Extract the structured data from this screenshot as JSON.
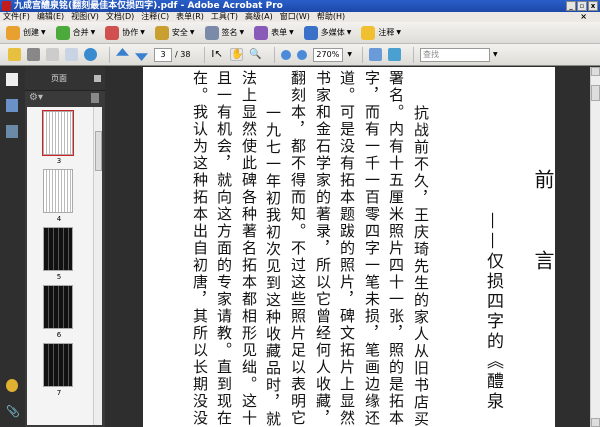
{
  "window": {
    "title": "九成宫醴泉铭(翻刻最佳本仅损四字).pdf - Adobe Acrobat Pro",
    "min": "_",
    "restore": "▫",
    "close": "x"
  },
  "menu": [
    "文件(F)",
    "编辑(E)",
    "视图(V)",
    "文档(D)",
    "注释(C)",
    "表单(R)",
    "工具(T)",
    "高级(A)",
    "窗口(W)",
    "帮助(H)"
  ],
  "menu_close": "×",
  "toolbar1": [
    {
      "label": "创建",
      "color": "#e8a030"
    },
    {
      "label": "合并",
      "color": "#4caa3c"
    },
    {
      "label": "协作",
      "color": "#d05050"
    },
    {
      "label": "安全",
      "color": "#c9a030"
    },
    {
      "label": "签名",
      "color": "#7a8aa8"
    },
    {
      "label": "表单",
      "color": "#8a5ab8"
    },
    {
      "label": "多媒体",
      "color": "#3a70c8"
    },
    {
      "label": "注释",
      "color": "#f0c030"
    }
  ],
  "toolbar2": {
    "current_page": "3",
    "total_pages": "/ 38",
    "zoom": "270%",
    "find_placeholder": "查找"
  },
  "panel": {
    "title": "页面",
    "thumbnails": [
      {
        "num": "3",
        "style": "text",
        "selected": true
      },
      {
        "num": "4",
        "style": "text"
      },
      {
        "num": "5",
        "style": "rubbing"
      },
      {
        "num": "6",
        "style": "rubbing"
      },
      {
        "num": "7",
        "style": "rubbing"
      }
    ]
  },
  "document": {
    "heading": [
      "前",
      "言"
    ],
    "subtitle": "——仅损四字的《醴泉",
    "columns": [
      "抗战前不久，王庆琦先生的家人从旧书店买到",
      "署名。内有十五厘米照片四十一张，照的是拓本欧",
      "字，而有一千一百零四字一笔未损，笔画边缘还",
      "道。可是没有拓本题跋的照片，碑文拓片上显然",
      "书家和金石学家的著录，所以它曾经何人收藏，",
      "翻刻本，都不得而知。不过这些照片足以表明它",
      "一九七一年初我初次见到这种收藏品时，就",
      "法上显然使此碑各种著名拓本都相形见绌。这十",
      "且一有机会，就向这方面的专家请教。直到现在",
      "在。我认为这种拓本出自初唐，其所以长期没没"
    ]
  }
}
